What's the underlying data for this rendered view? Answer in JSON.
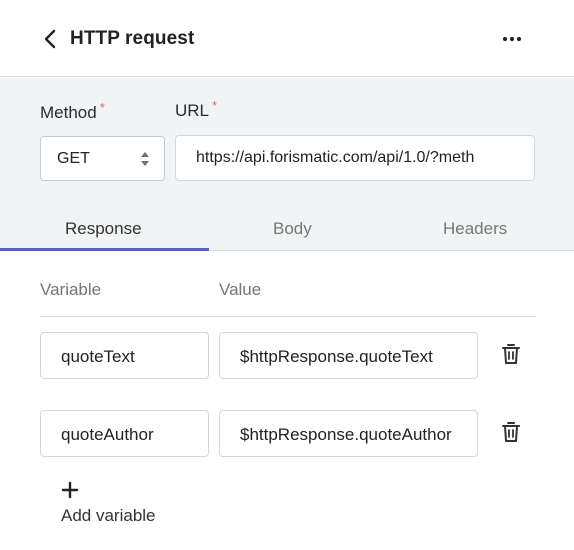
{
  "header": {
    "title": "HTTP request",
    "back_icon": "chevron-left-icon",
    "more_icon": "more-horizontal-icon"
  },
  "method": {
    "label": "Method",
    "required_mark": "*",
    "value": "GET"
  },
  "url": {
    "label": "URL",
    "required_mark": "*",
    "value": "https://api.forismatic.com/api/1.0/?meth"
  },
  "tabs": [
    {
      "label": "Response",
      "active": true
    },
    {
      "label": "Body",
      "active": false
    },
    {
      "label": "Headers",
      "active": false
    }
  ],
  "response": {
    "columns": {
      "variable": "Variable",
      "value": "Value"
    },
    "rows": [
      {
        "variable": "quoteText",
        "value": "$httpResponse.quoteText"
      },
      {
        "variable": "quoteAuthor",
        "value": "$httpResponse.quoteAuthor"
      }
    ],
    "add_label": "Add variable"
  },
  "colors": {
    "accent": "#5661c7",
    "required": "#e86a5e",
    "panel_bg": "#f1f3f4"
  }
}
